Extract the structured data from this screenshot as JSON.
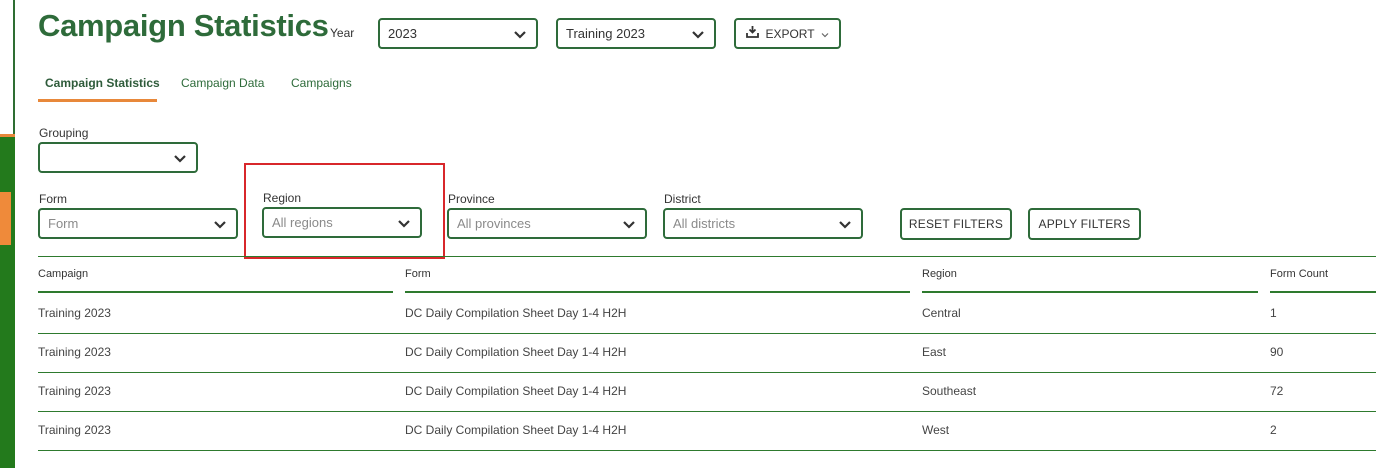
{
  "header": {
    "title": "Campaign Statistics",
    "year_label": "Year",
    "year_value": "2023",
    "campaign_value": "Training 2023",
    "export_label": "EXPORT"
  },
  "tabs": [
    {
      "label": "Campaign Statistics",
      "active": true
    },
    {
      "label": "Campaign Data",
      "active": false
    },
    {
      "label": "Campaigns",
      "active": false
    }
  ],
  "filters": {
    "grouping_label": "Grouping",
    "grouping_value": "",
    "form_label": "Form",
    "form_placeholder": "Form",
    "region_label": "Region",
    "region_placeholder": "All regions",
    "province_label": "Province",
    "province_placeholder": "All provinces",
    "district_label": "District",
    "district_placeholder": "All districts",
    "reset_label": "RESET FILTERS",
    "apply_label": "APPLY FILTERS"
  },
  "table": {
    "columns": [
      "Campaign",
      "Form",
      "Region",
      "Form Count"
    ],
    "rows": [
      [
        "Training 2023",
        "DC Daily Compilation Sheet Day 1-4 H2H",
        "Central",
        "1"
      ],
      [
        "Training 2023",
        "DC Daily Compilation Sheet Day 1-4 H2H",
        "East",
        "90"
      ],
      [
        "Training 2023",
        "DC Daily Compilation Sheet Day 1-4 H2H",
        "Southeast",
        "72"
      ],
      [
        "Training 2023",
        "DC Daily Compilation Sheet Day 1-4 H2H",
        "West",
        "2"
      ]
    ]
  },
  "colors": {
    "accent": "#2e6b3a",
    "tab_underline": "#e8883a",
    "highlight": "#d8272b",
    "rail": "#237a1c"
  }
}
